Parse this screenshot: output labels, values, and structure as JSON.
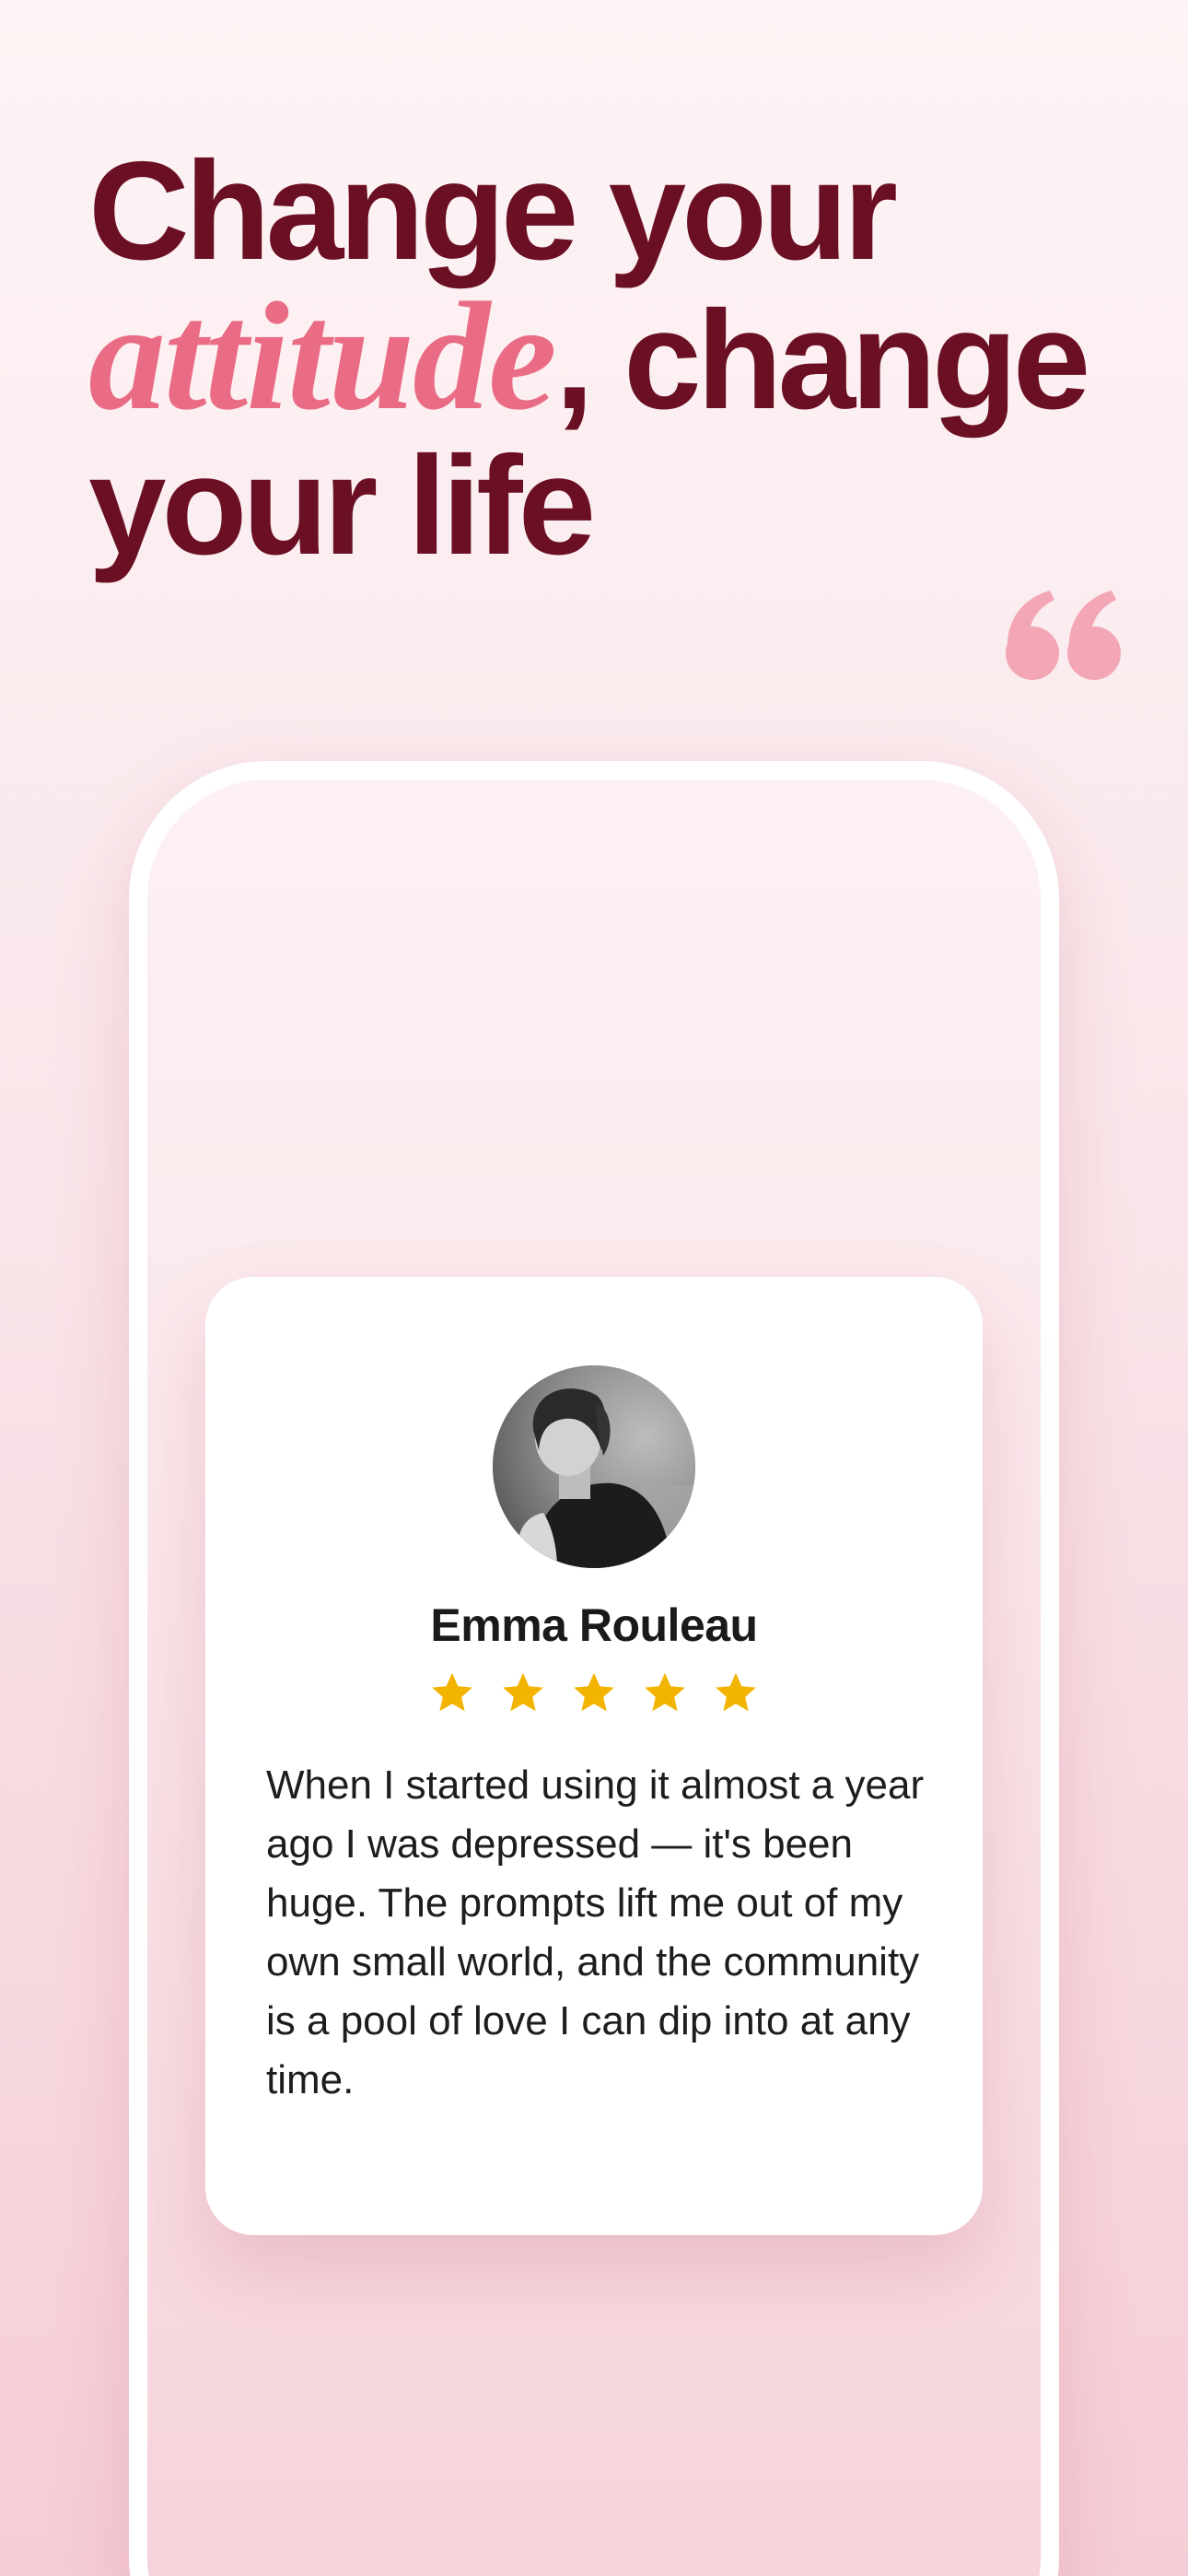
{
  "headline": {
    "line1": "Change your",
    "accent_word": "attitude",
    "line2_rest": ", change",
    "line3": "your life"
  },
  "colors": {
    "headline": "#6b0f24",
    "accent": "#ea6c84",
    "quote_mark": "#f3a6b5",
    "star": "#f3b400",
    "background_top": "#fdf4f5",
    "background_bottom": "#f5cdd6"
  },
  "icons": {
    "quote": "quote-mark-icon",
    "star": "star-icon"
  },
  "review": {
    "name": "Emma Rouleau",
    "rating": 5,
    "rating_max": 5,
    "text": "When I started using it almost a year ago I was depressed — it's been huge. The prompts lift me out of my own small world, and the community is a pool of love I can dip into at any time."
  }
}
